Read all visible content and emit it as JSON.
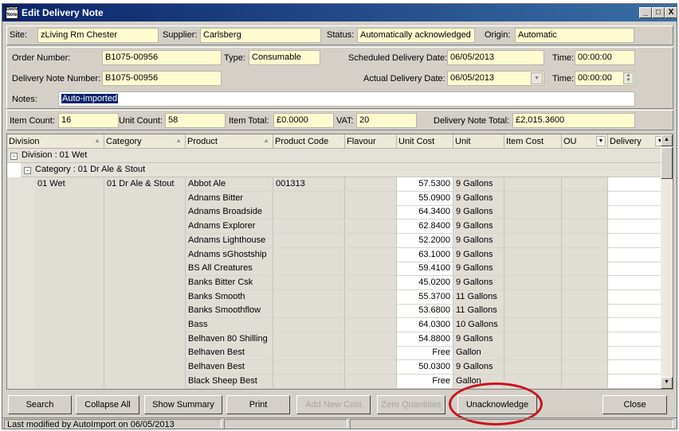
{
  "window": {
    "title": "Edit Delivery Note",
    "icon_text": "Delivery Note",
    "controls": [
      "_",
      "□",
      "X"
    ]
  },
  "header": {
    "site_label": "Site:",
    "site": "zLiving Rm Chester",
    "supplier_label": "Supplier:",
    "supplier": "Carlsberg",
    "status_label": "Status:",
    "status": "Automatically acknowledged",
    "origin_label": "Origin:",
    "origin": "Automatic"
  },
  "order": {
    "order_number_label": "Order Number:",
    "order_number": "B1075-00956",
    "type_label": "Type:",
    "type": "Consumable",
    "scheduled_date_label": "Scheduled Delivery Date:",
    "scheduled_date": "06/05/2013",
    "scheduled_time_label": "Time:",
    "scheduled_time": "00:00:00"
  },
  "delivery": {
    "dn_number_label": "Delivery Note Number:",
    "dn_number": "B1075-00956",
    "actual_date_label": "Actual Delivery Date:",
    "actual_date": "06/05/2013",
    "actual_time_label": "Time:",
    "actual_time": "00:00:00"
  },
  "notes": {
    "label": "Notes:",
    "value": "Auto-imported"
  },
  "totals": {
    "item_count_label": "Item Count:",
    "item_count": "16",
    "unit_count_label": "Unit Count:",
    "unit_count": "58",
    "item_total_label": "Item Total:",
    "item_total": "£0.0000",
    "vat_label": "VAT:",
    "vat": "20",
    "dn_total_label": "Delivery Note Total:",
    "dn_total": "£2,015.3600"
  },
  "grid": {
    "columns": [
      "Division",
      "Category",
      "Product",
      "Product Code",
      "Flavour",
      "Unit Cost",
      "Unit",
      "Item Cost",
      "OU",
      "Delivery"
    ],
    "division_group": "Division : 01 Wet",
    "category_group": "Category : 01 Dr Ale & Stout",
    "division_value": "01 Wet",
    "category_value": "01 Dr Ale & Stout",
    "rows": [
      {
        "product": "Abbot Ale",
        "code": "001313",
        "unit_cost": "57.5300",
        "unit": "9 Gallons"
      },
      {
        "product": "Adnams Bitter",
        "code": "",
        "unit_cost": "55.0900",
        "unit": "9 Gallons"
      },
      {
        "product": "Adnams Broadside",
        "code": "",
        "unit_cost": "64.3400",
        "unit": "9 Gallons"
      },
      {
        "product": "Adnams Explorer",
        "code": "",
        "unit_cost": "62.8400",
        "unit": "9 Gallons"
      },
      {
        "product": "Adnams Lighthouse",
        "code": "",
        "unit_cost": "52.2000",
        "unit": "9 Gallons"
      },
      {
        "product": "Adnams sGhostship",
        "code": "",
        "unit_cost": "63.1000",
        "unit": "9 Gallons"
      },
      {
        "product": "BS All Creatures",
        "code": "",
        "unit_cost": "59.4100",
        "unit": "9 Gallons"
      },
      {
        "product": "Banks Bitter Csk",
        "code": "",
        "unit_cost": "45.0200",
        "unit": "9 Gallons"
      },
      {
        "product": "Banks Smooth",
        "code": "",
        "unit_cost": "55.3700",
        "unit": "11 Gallons"
      },
      {
        "product": "Banks Smoothflow",
        "code": "",
        "unit_cost": "53.6800",
        "unit": "11 Gallons"
      },
      {
        "product": "Bass",
        "code": "",
        "unit_cost": "64.0300",
        "unit": "10 Gallons"
      },
      {
        "product": "Belhaven 80 Shilling",
        "code": "",
        "unit_cost": "54.8800",
        "unit": "9 Gallons"
      },
      {
        "product": "Belhaven Best",
        "code": "",
        "unit_cost": "Free",
        "unit": "Gallon"
      },
      {
        "product": "Belhaven Best",
        "code": "",
        "unit_cost": "50.0300",
        "unit": "9 Gallons"
      },
      {
        "product": "Black Sheep Best",
        "code": "",
        "unit_cost": "Free",
        "unit": "Gallon"
      }
    ]
  },
  "buttons": {
    "search": "Search",
    "collapse_all": "Collapse All",
    "show_summary": "Show Summary",
    "print": "Print",
    "add_new_cost": "Add New Cost",
    "zero_quantities": "Zero Quantities",
    "unacknowledge": "Unacknowledge",
    "close": "Close"
  },
  "statusbar": {
    "text": "Last modified by AutoImport on 06/05/2013"
  },
  "highlight_color": "#c8141e"
}
